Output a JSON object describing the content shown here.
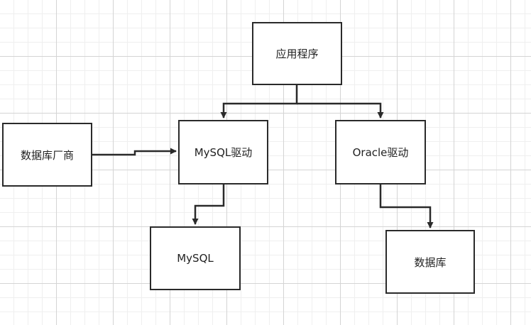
{
  "nodes": {
    "app": "应用程序",
    "vendor": "数据库厂商",
    "mysql_driver": "MySQL驱动",
    "oracle_driver": "Oracle驱动",
    "mysql": "MySQL",
    "database": "数据库"
  }
}
